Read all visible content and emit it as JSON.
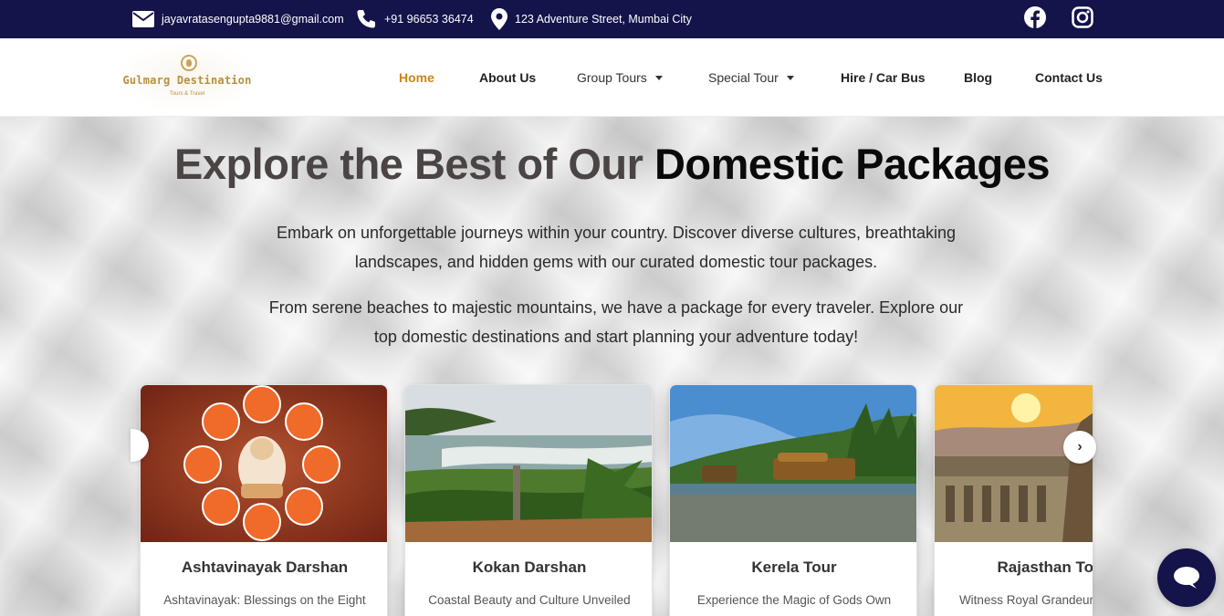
{
  "topbar": {
    "email": "jayavratasengupta9881@gmail.com",
    "phone": "+91 96653 36474",
    "address": "123 Adventure Street, Mumbai City",
    "icons": [
      "envelope-icon",
      "phone-icon",
      "location-pin-icon",
      "facebook-icon",
      "instagram-icon"
    ],
    "background": "#14134a"
  },
  "logo": {
    "name": "Gulmarg Destination",
    "tagline": "Tours & Travel"
  },
  "nav": {
    "items": [
      {
        "label": "Home",
        "active": true
      },
      {
        "label": "About Us"
      },
      {
        "label": "Group Tours",
        "dropdown": true
      },
      {
        "label": "Special Tour",
        "dropdown": true
      },
      {
        "label": "Hire / Car Bus"
      },
      {
        "label": "Blog"
      },
      {
        "label": "Contact Us"
      }
    ],
    "active_color": "#c9851b"
  },
  "hero": {
    "title_part1": "Explore the Best of Our ",
    "title_part2": "Domestic Packages",
    "paragraph1": "Embark on unforgettable journeys within your country. Discover diverse cultures, breathtaking landscapes, and hidden gems with our curated domestic tour packages.",
    "paragraph2": "From serene beaches to majestic mountains, we have a package for every traveler. Explore our top domestic destinations and start planning your adventure today!"
  },
  "cards": [
    {
      "title": "Ashtavinayak Darshan",
      "desc": "Ashtavinayak: Blessings on the Eight"
    },
    {
      "title": "Kokan Darshan",
      "desc": "Coastal Beauty and Culture Unveiled"
    },
    {
      "title": "Kerela Tour",
      "desc": "Experience the Magic of Gods Own"
    },
    {
      "title": "Rajasthan To",
      "desc": "Witness Royal Grandeur"
    }
  ],
  "carousel": {
    "next_icon": "›"
  },
  "chat": {
    "icon": "chat-bubble-icon"
  }
}
